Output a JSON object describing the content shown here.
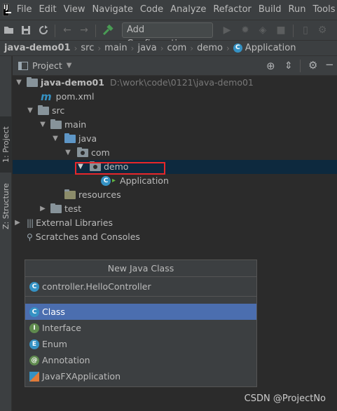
{
  "menubar": {
    "logo_text": "IJ",
    "items": [
      "File",
      "Edit",
      "View",
      "Navigate",
      "Code",
      "Analyze",
      "Refactor",
      "Build",
      "Run",
      "Tools"
    ]
  },
  "toolbar": {
    "add_configuration_label": "Add Configuration..."
  },
  "breadcrumb": {
    "items": [
      "java-demo01",
      "src",
      "main",
      "java",
      "com",
      "demo",
      "Application"
    ]
  },
  "side_tabs": {
    "project": "1: Project",
    "structure": "Z: Structure"
  },
  "project_panel": {
    "title": "Project"
  },
  "tree": {
    "module_name": "java-demo01",
    "module_path": "D:\\work\\code\\0121\\java-demo01",
    "pom": "pom.xml",
    "src": "src",
    "main": "main",
    "java": "java",
    "com": "com",
    "demo": "demo",
    "application": "Application",
    "resources": "resources",
    "test": "test",
    "external_libraries": "External Libraries",
    "scratches": "Scratches and Consoles"
  },
  "popup": {
    "title": "New Java Class",
    "input_value": "controller.HelloController",
    "options": [
      {
        "label": "Class",
        "icon_letter": "C",
        "selected": true
      },
      {
        "label": "Interface",
        "icon_letter": "I",
        "selected": false
      },
      {
        "label": "Enum",
        "icon_letter": "E",
        "selected": false
      },
      {
        "label": "Annotation",
        "icon_letter": "@",
        "selected": false
      },
      {
        "label": "JavaFXApplication",
        "icon_letter": "",
        "selected": false
      }
    ]
  },
  "watermark": "CSDN @ProjectNo",
  "colors": {
    "background": "#2b2b2b",
    "selection": "#4b6eaf",
    "tree_selection": "#0d293e",
    "highlight_box": "#e6272a"
  }
}
